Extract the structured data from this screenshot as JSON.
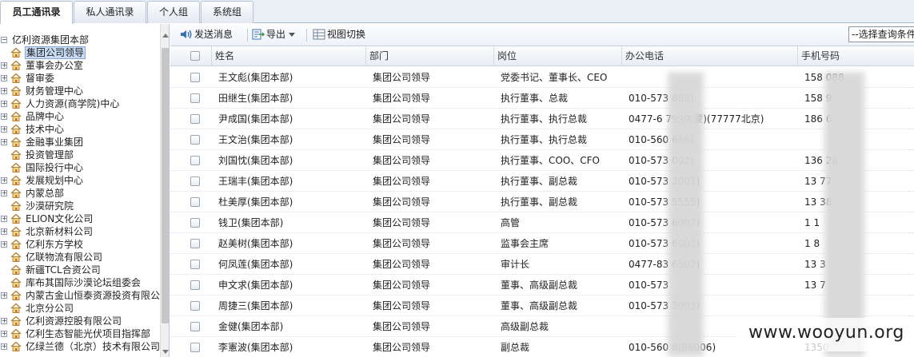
{
  "tabs": [
    {
      "label": "员工通讯录",
      "active": true
    },
    {
      "label": "私人通讯录",
      "active": false
    },
    {
      "label": "个人组",
      "active": false
    },
    {
      "label": "系统组",
      "active": false
    }
  ],
  "tree": {
    "root": "亿利资源集团本部",
    "items": [
      {
        "label": "集团公司领导",
        "selected": true,
        "expandable": false
      },
      {
        "label": "董事会办公室",
        "expandable": true
      },
      {
        "label": "督审委",
        "expandable": true
      },
      {
        "label": "财务管理中心",
        "expandable": true
      },
      {
        "label": "人力资源(商学院)中心",
        "expandable": true
      },
      {
        "label": "品牌中心",
        "expandable": true
      },
      {
        "label": "技术中心",
        "expandable": true
      },
      {
        "label": "金融事业集团",
        "expandable": true
      },
      {
        "label": "投资管理部",
        "expandable": false
      },
      {
        "label": "国际投行中心",
        "expandable": false
      },
      {
        "label": "发展规划中心",
        "expandable": true
      },
      {
        "label": "内蒙总部",
        "expandable": true
      },
      {
        "label": "沙漠研究院",
        "expandable": false
      },
      {
        "label": "ELION文化公司",
        "expandable": true
      },
      {
        "label": "北京新材料公司",
        "expandable": true
      },
      {
        "label": "亿利东方学校",
        "expandable": true
      },
      {
        "label": "亿联物流有限公司",
        "expandable": false
      },
      {
        "label": "新疆TCL合资公司",
        "expandable": false
      },
      {
        "label": "库布其国际沙漠论坛组委会",
        "expandable": false
      },
      {
        "label": "内蒙古金山恒泰资源投资有限公",
        "expandable": true
      },
      {
        "label": "北京分公司",
        "expandable": false
      },
      {
        "label": "亿利资源控股有限公司",
        "expandable": true
      },
      {
        "label": "亿利生态智能光伏项目指挥部",
        "expandable": true
      },
      {
        "label": "亿绿兰德（北京）技术有限公司",
        "expandable": true
      }
    ]
  },
  "toolbar": {
    "send_message": "发送消息",
    "export": "导出",
    "view_switch": "视图切换",
    "query_select": "--选择查询条件"
  },
  "grid": {
    "headers": {
      "name": "姓名",
      "dept": "部门",
      "post": "岗位",
      "office_phone": "办公电话",
      "mobile": "手机号码"
    },
    "rows": [
      {
        "name": "王文彪(集团本部)",
        "dept": "集团公司领导",
        "post": "党委书记、董事长、CEO",
        "office_phone": "",
        "mobile": "158      088"
      },
      {
        "name": "田继生(集团本部)",
        "dept": "集团公司领导",
        "post": "执行董事、总裁",
        "office_phone": "010-573        888)",
        "mobile": "158       9"
      },
      {
        "name": "尹成国(集团本部)",
        "dept": "集团公司领导",
        "post": "执行董事、执行总裁",
        "office_phone": "0477-6      799内蒙)(77777北京)",
        "mobile": "186       6"
      },
      {
        "name": "王文治(集团本部)",
        "dept": "集团公司领导",
        "post": "执行董事、执行总裁",
        "office_phone": "010-560        666)",
        "mobile": ""
      },
      {
        "name": "刘国忱(集团本部)",
        "dept": "集团公司领导",
        "post": "执行董事、COO、CFO",
        "office_phone": "010-573        002)",
        "mobile": "136       28"
      },
      {
        "name": "王瑞丰(集团本部)",
        "dept": "集团公司领导",
        "post": "执行董事、副总裁",
        "office_phone": "010-573        2001)",
        "mobile": "13        77"
      },
      {
        "name": "杜美厚(集团本部)",
        "dept": "集团公司领导",
        "post": "执行董事、副总裁",
        "office_phone": "010-573        5555)",
        "mobile": "13        38"
      },
      {
        "name": "钱卫(集团本部)",
        "dept": "集团公司领导",
        "post": "高管",
        "office_phone": "010-573        6007)",
        "mobile": "1         1"
      },
      {
        "name": "赵美树(集团本部)",
        "dept": "集团公司领导",
        "post": "监事会主席",
        "office_phone": "010-573        6001)",
        "mobile": "1         8"
      },
      {
        "name": "何凤莲(集团本部)",
        "dept": "集团公司领导",
        "post": "审计长",
        "office_phone": "0477-83        6502)",
        "mobile": "13        3"
      },
      {
        "name": "申文求(集团本部)",
        "dept": "集团公司领导",
        "post": "董事、高级副总裁",
        "office_phone": "010-573",
        "mobile": "13        7"
      },
      {
        "name": "周捷三(集团本部)",
        "dept": "集团公司领导",
        "post": "董事、高级副总裁",
        "office_phone": "010-573        3003)",
        "mobile": ""
      },
      {
        "name": "金健(集团本部)",
        "dept": "集团公司领导",
        "post": "高级副总裁",
        "office_phone": "",
        "mobile": ""
      },
      {
        "name": "李憲波(集团本部)",
        "dept": "集团公司领导",
        "post": "副总裁",
        "office_phone": "010-560      8(86006)",
        "mobile": "1350"
      }
    ]
  },
  "watermark": "www.wooyun.org",
  "colors": {
    "accent": "#c9dcf5",
    "border": "#b9c7da",
    "header_bg": "#e9edf3"
  }
}
